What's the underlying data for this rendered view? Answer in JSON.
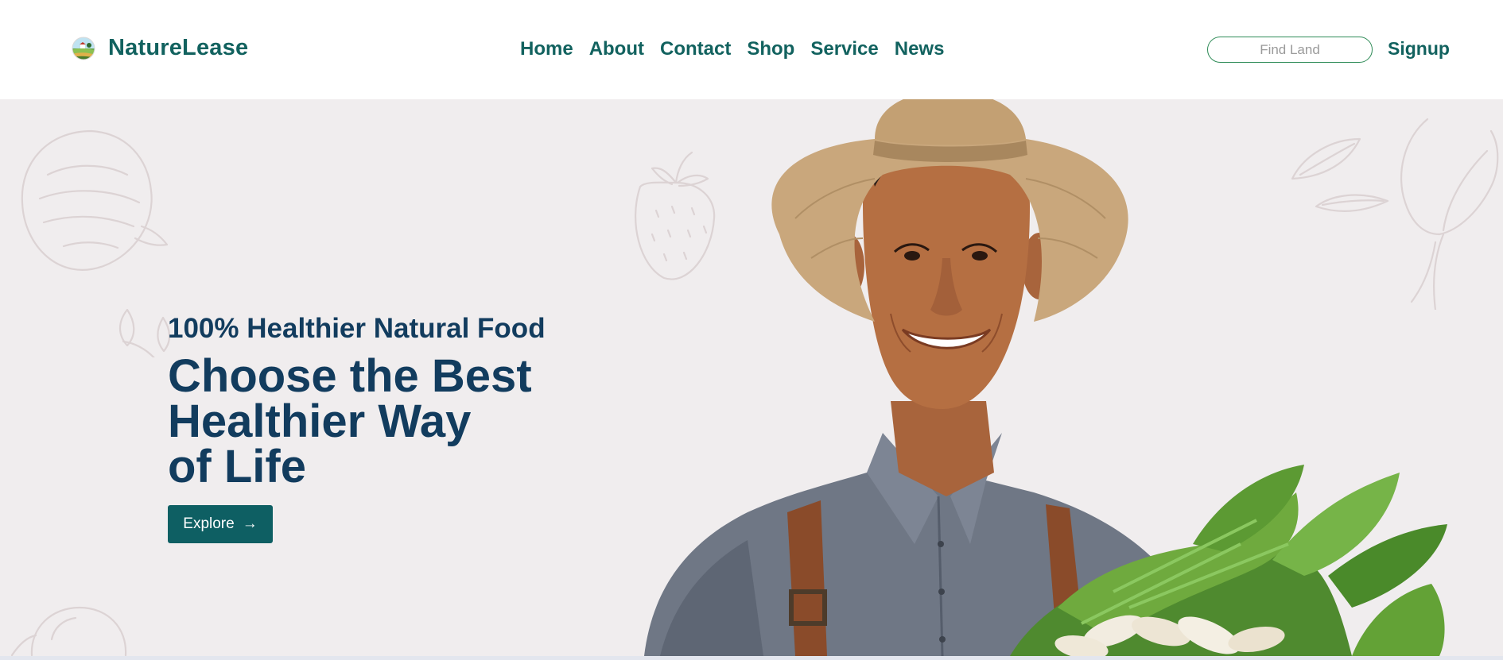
{
  "brand": {
    "name": "NatureLease",
    "logo_icon": "farm-globe-logo"
  },
  "nav": {
    "items": [
      {
        "label": "Home"
      },
      {
        "label": "About"
      },
      {
        "label": "Contact"
      },
      {
        "label": "Shop"
      },
      {
        "label": "Service"
      },
      {
        "label": "News"
      }
    ]
  },
  "search": {
    "placeholder": "Find Land",
    "value": ""
  },
  "signup_label": "Signup",
  "hero": {
    "subtitle": "100% Healthier Natural Food",
    "headline": [
      "Choose the Best",
      "Healthier Way",
      "of Life"
    ],
    "button_label": "Explore",
    "button_icon": "arrow-right-icon",
    "arrow_glyph": "→",
    "image": "smiling-farmer-with-vegetables"
  },
  "colors": {
    "brand_teal": "#12625f",
    "headline_navy": "#123c5e",
    "button_bg": "#0e5f63",
    "hero_bg": "#f0edee",
    "search_border": "#2e8b57"
  }
}
